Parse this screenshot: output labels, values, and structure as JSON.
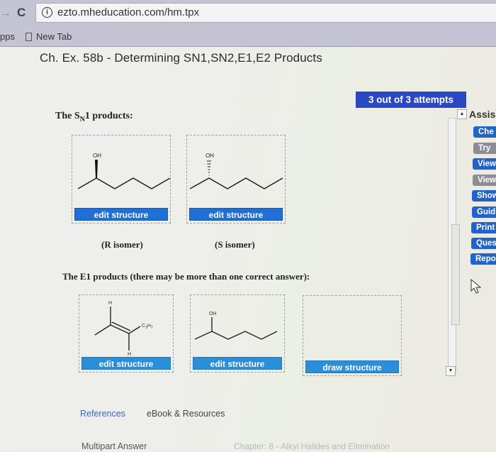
{
  "browser": {
    "url": "ezto.mheducation.com/hm.tpx",
    "bookmarks": [
      "pps",
      "New Tab"
    ]
  },
  "page": {
    "title": "Ch. Ex. 58b - Determining SN1,SN2,E1,E2 Products",
    "attempts": "3 out of 3 attempts"
  },
  "question": {
    "sn1_prefix": "The S",
    "sn1_sub": "N",
    "sn1_suffix": "1 products:",
    "sn1_structures": [
      {
        "label_oh": "OH",
        "button": "edit structure",
        "stereo": "wedge"
      },
      {
        "label_oh": "OH",
        "button": "edit structure",
        "stereo": "hash"
      }
    ],
    "isomer_labels": [
      "(R isomer)",
      "(S isomer)"
    ],
    "e1_prompt": "The E1 products (there may be more than one correct answer):",
    "e1_structures": [
      {
        "labels": [
          "H",
          "C3H7",
          "H"
        ],
        "button": "edit structure"
      },
      {
        "labels": [
          "OH"
        ],
        "button": "edit structure"
      },
      {
        "labels": [],
        "button": "draw structure"
      }
    ]
  },
  "assistance": {
    "title": "Assis",
    "buttons": [
      {
        "label": "Che",
        "state": "active"
      },
      {
        "label": "Try",
        "state": "disabled"
      },
      {
        "label": "View",
        "state": "active"
      },
      {
        "label": "View",
        "state": "disabled"
      },
      {
        "label": "Show",
        "state": "active"
      },
      {
        "label": "Guid",
        "state": "active"
      },
      {
        "label": "Print",
        "state": "active"
      },
      {
        "label": "Ques",
        "state": "active"
      },
      {
        "label": "Repo",
        "state": "active"
      }
    ]
  },
  "footer": {
    "references": "References",
    "ebook": "eBook & Resources",
    "multipart": "Multipart Answer",
    "chapter": "Chapter: 8 - Alkyl Halides and Elimination"
  },
  "scrollbar": {
    "up": "▲",
    "down": "▼"
  }
}
